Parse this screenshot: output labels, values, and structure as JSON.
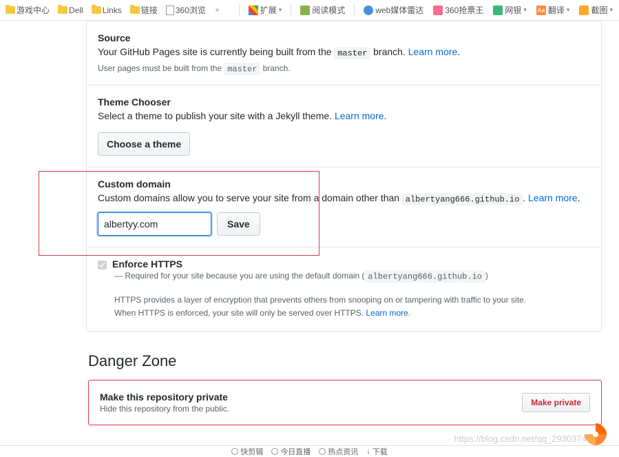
{
  "browser_bar": {
    "bookmarks": [
      {
        "label": "游戏中心",
        "type": "folder"
      },
      {
        "label": "Dell",
        "type": "folder"
      },
      {
        "label": "Links",
        "type": "folder"
      },
      {
        "label": "链接",
        "type": "folder"
      },
      {
        "label": "360浏览",
        "type": "page"
      }
    ],
    "more": "»",
    "extensions": [
      {
        "label": "扩展",
        "icon": "apps",
        "chevron": true
      },
      {
        "label": "阅读模式",
        "icon": "read"
      },
      {
        "label": "web媒体雷达",
        "icon": "web"
      },
      {
        "label": "360抢票王",
        "icon": "ticket"
      },
      {
        "label": "网银",
        "icon": "bank",
        "chevron": true
      },
      {
        "label": "翻译",
        "icon": "trans",
        "badge": "Aa",
        "chevron": true
      },
      {
        "label": "截图",
        "icon": "shot",
        "chevron": true
      }
    ]
  },
  "source": {
    "title": "Source",
    "desc_pre": "Your GitHub Pages site is currently being built from the ",
    "desc_code": "master",
    "desc_post": " branch. ",
    "learn_more": "Learn more",
    "note_pre": "User pages must be built from the ",
    "note_code": "master",
    "note_post": " branch."
  },
  "theme": {
    "title": "Theme Chooser",
    "desc": "Select a theme to publish your site with a Jekyll theme. ",
    "learn_more": "Learn more",
    "button": "Choose a theme"
  },
  "custom_domain": {
    "title": "Custom domain",
    "desc_pre": "Custom domains allow you to serve your site from a domain other than ",
    "desc_code": "albertyang666.github.io",
    "desc_post": ". ",
    "learn_more": "Learn more",
    "input_value": "albertyy.com",
    "save": "Save"
  },
  "https": {
    "label": "Enforce HTTPS",
    "sub_pre": "— Required for your site because you are using the default domain (",
    "sub_code": "albertyang666.github.io",
    "sub_post": ")",
    "note1": "HTTPS provides a layer of encryption that prevents others from snooping on or tampering with traffic to your site.",
    "note2_pre": "When HTTPS is enforced, your site will only be served over HTTPS. ",
    "learn_more": "Learn more"
  },
  "danger": {
    "heading": "Danger Zone",
    "private_title": "Make this repository private",
    "private_desc": "Hide this repository from the public.",
    "private_button": "Make private"
  },
  "bottom": {
    "items": [
      "快剪辑",
      "今日直播",
      "热点资讯",
      "下载"
    ]
  },
  "watermark": "https://blog.csdn.net/qq_29303743",
  "period": "."
}
